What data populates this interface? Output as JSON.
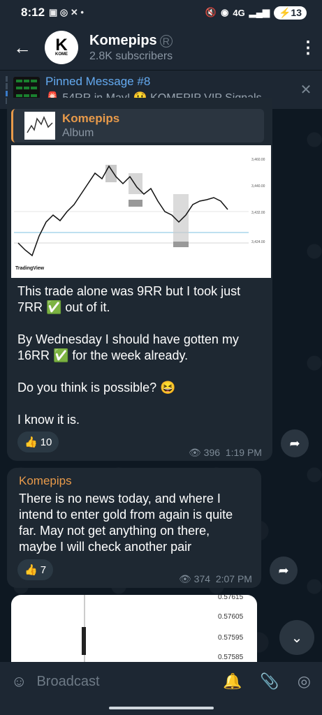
{
  "status": {
    "time": "8:12",
    "battery": "13",
    "net": "4G"
  },
  "header": {
    "title": "Komepips",
    "subtitle": "2.8K subscribers",
    "avatar_text": "K",
    "avatar_sub": "KOME"
  },
  "pinned": {
    "title": "Pinned Message #8",
    "preview": "🚨 54RR in May! 😲  KOMEPIP VIP Signals..."
  },
  "messages": [
    {
      "reply_name": "Komepips",
      "reply_sub": "Album",
      "lines": [
        "This trade alone was 9RR but I took just",
        "7RR ✅ out of it.",
        "",
        "By Wednesday I should have gotten my",
        "16RR ✅ for the week already.",
        "",
        "Do you think is possible? 😆",
        "",
        "I know it is."
      ],
      "reaction_emoji": "👍",
      "reaction_count": "10",
      "views": "396",
      "time": "1:19 PM"
    },
    {
      "sender": "Komepips",
      "lines": [
        "There is no news today, and where I",
        "intend to enter gold from again is quite",
        "far. May not get anything on there,",
        "maybe I will check another pair"
      ],
      "reaction_emoji": "👍",
      "reaction_count": "7",
      "views": "374",
      "time": "2:07 PM"
    }
  ],
  "chart2_ticks": [
    "0.57615",
    "0.57605",
    "0.57595",
    "0.57585"
  ],
  "tv_label": "TradingView",
  "composer": {
    "placeholder": "Broadcast"
  }
}
